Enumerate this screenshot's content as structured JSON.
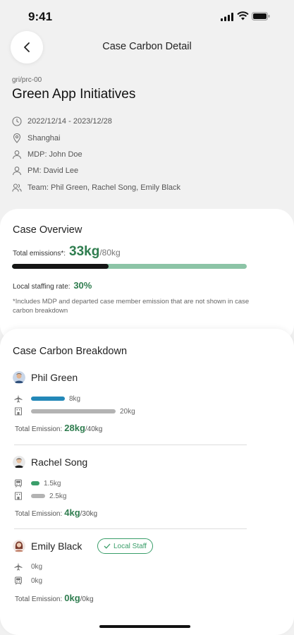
{
  "status": {
    "time": "9:41"
  },
  "nav": {
    "title": "Case Carbon Detail",
    "back_icon": "chevron-left-icon"
  },
  "case": {
    "code": "gri/prc-00",
    "title": "Green App Initiatives",
    "dates": "2022/12/14 - 2023/12/28",
    "location": "Shanghai",
    "mdp": "MDP: John Doe",
    "pm": "PM: David Lee",
    "team": "Team: Phil Green, Rachel Song, Emily Black"
  },
  "overview": {
    "title": "Case Overview",
    "total_label": "Total emissions*:",
    "total_value": "33kg",
    "total_max": "/80kg",
    "progress_fraction": 0.4125,
    "staffing_label": "Local staffing rate:",
    "staffing_value": "30%",
    "note": "*Includes MDP and departed case member emission that are not shown in case carbon breakdown"
  },
  "breakdown": {
    "title": "Case Carbon Breakdown",
    "members": [
      {
        "name": "Phil Green",
        "rows": [
          {
            "icon": "airplane-icon",
            "value": "8kg",
            "fraction": 0.2,
            "color": "#2388b8"
          },
          {
            "icon": "hotel-icon",
            "value": "20kg",
            "fraction": 0.5,
            "color": "#b3b3b3"
          }
        ],
        "total_label": "Total Emission:",
        "total_value": "28kg",
        "total_max": "/40kg"
      },
      {
        "name": "Rachel Song",
        "rows": [
          {
            "icon": "train-icon",
            "value": "1.5kg",
            "fraction": 0.05,
            "color": "#3a9e6a"
          },
          {
            "icon": "hotel-icon",
            "value": "2.5kg",
            "fraction": 0.08333,
            "color": "#b3b3b3"
          }
        ],
        "total_label": "Total Emission:",
        "total_value": "4kg",
        "total_max": "/30kg"
      },
      {
        "name": "Emily Black",
        "badge": "Local Staff",
        "rows": [
          {
            "icon": "airplane-icon",
            "value": "0kg",
            "fraction": 0
          },
          {
            "icon": "train-icon",
            "value": "0kg",
            "fraction": 0
          }
        ],
        "total_label": "Total Emission:",
        "total_value": "0kg",
        "total_max": "/0kg"
      }
    ]
  }
}
